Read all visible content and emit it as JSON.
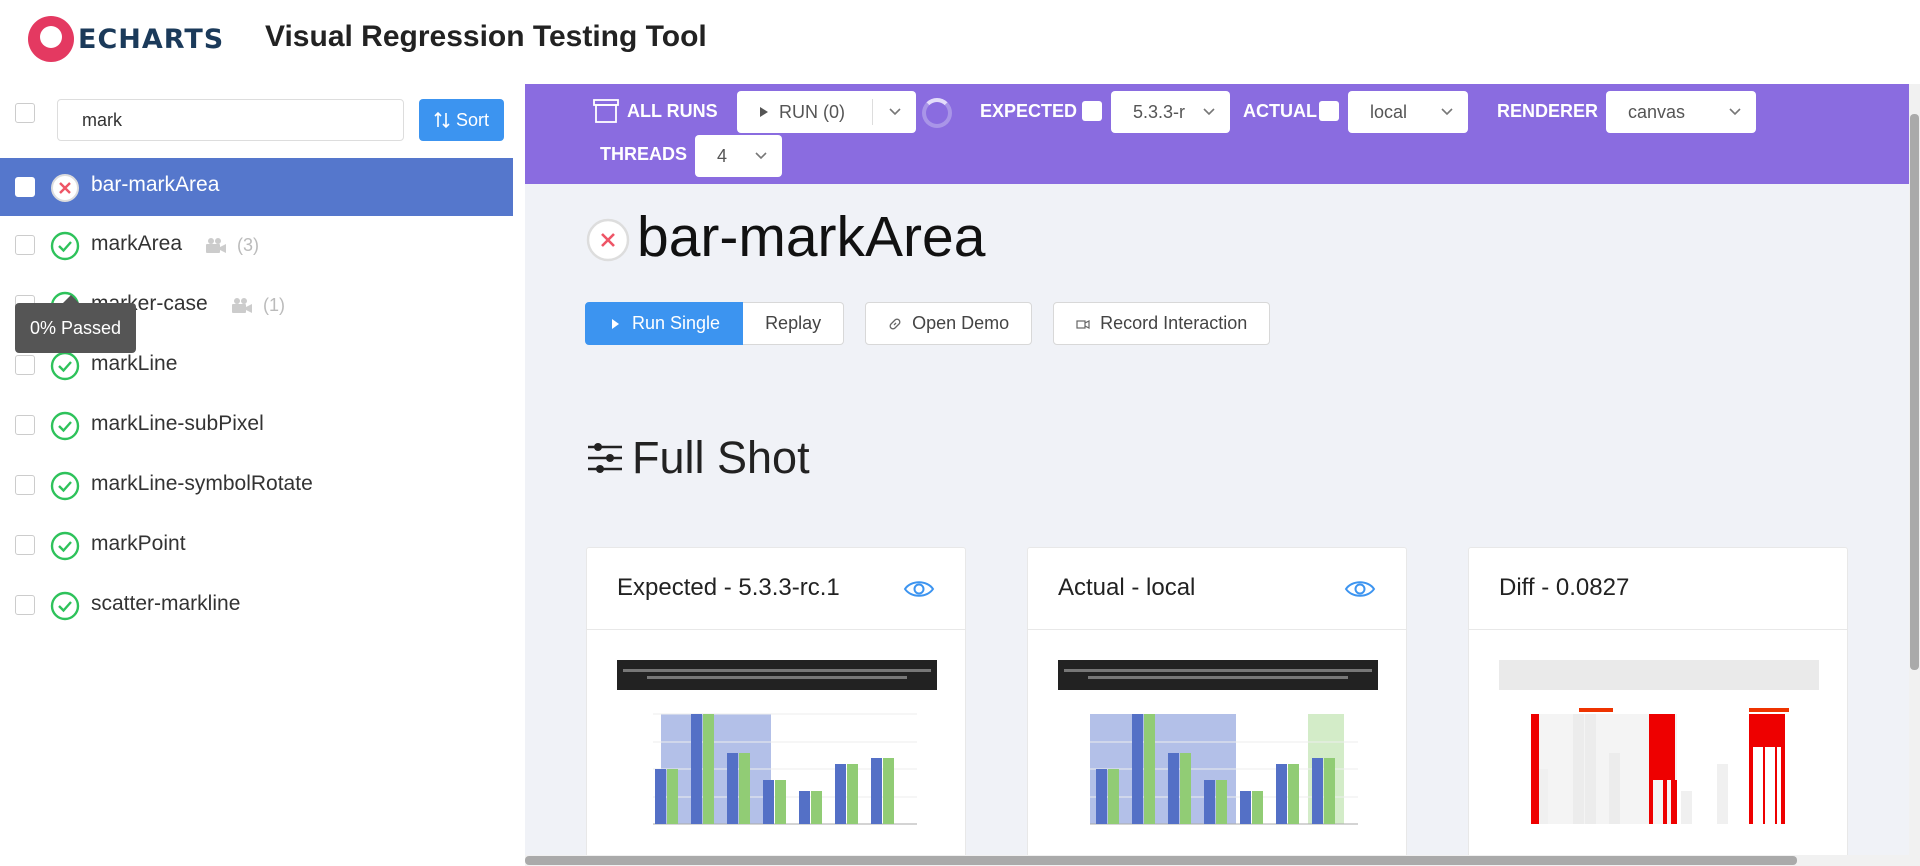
{
  "header": {
    "logo_text": "ECHARTS",
    "title": "Visual Regression Testing Tool"
  },
  "sidebar": {
    "search_value": "mark",
    "sort_label": "Sort",
    "cases": [
      {
        "name": "bar-markArea",
        "status": "failed",
        "selected": true,
        "recordings": ""
      },
      {
        "name": "markArea",
        "status": "passed",
        "selected": false,
        "recordings": "(3)"
      },
      {
        "name": "marker-case",
        "status": "passed",
        "selected": false,
        "recordings": "(1)"
      },
      {
        "name": "markLine",
        "status": "passed",
        "selected": false,
        "recordings": ""
      },
      {
        "name": "markLine-subPixel",
        "status": "passed",
        "selected": false,
        "recordings": ""
      },
      {
        "name": "markLine-symbolRotate",
        "status": "passed",
        "selected": false,
        "recordings": ""
      },
      {
        "name": "markPoint",
        "status": "passed",
        "selected": false,
        "recordings": ""
      },
      {
        "name": "scatter-markline",
        "status": "passed",
        "selected": false,
        "recordings": ""
      }
    ],
    "tooltip": "0% Passed"
  },
  "toolbar": {
    "all_runs": "ALL RUNS",
    "run_label": "RUN (0)",
    "expected_label": "EXPECTED",
    "expected_version": "5.3.3-r",
    "actual_label": "ACTUAL",
    "actual_version": "local",
    "renderer_label": "RENDERER",
    "renderer_value": "canvas",
    "threads_label": "THREADS",
    "threads_value": "4"
  },
  "main": {
    "case_title": "bar-markArea",
    "buttons": {
      "run_single": "Run Single",
      "replay": "Replay",
      "open_demo": "Open Demo",
      "record_interaction": "Record Interaction"
    },
    "section_title": "Full Shot",
    "cards": [
      {
        "title": "Expected - 5.3.3-rc.1",
        "has_eye": true
      },
      {
        "title": "Actual - local",
        "has_eye": true
      },
      {
        "title": "Diff - 0.0827",
        "has_eye": false
      }
    ]
  },
  "colors": {
    "toolbar_bg": "#8a6ce0",
    "primary": "#3c94f0",
    "selected_row": "#5577cc",
    "pass": "#2ec25b",
    "fail": "#ee5566"
  }
}
